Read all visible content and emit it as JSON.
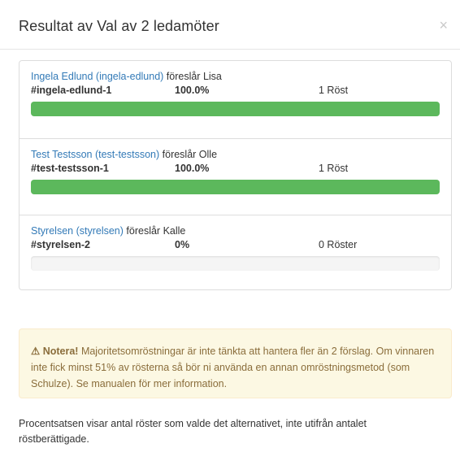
{
  "modal": {
    "title": "Resultat av Val av 2 ledamöter",
    "close_label": "×"
  },
  "results": [
    {
      "proposer_link": "Ingela Edlund (ingela-edlund)",
      "proposer_text": " föreslår Lisa",
      "alt_id": "#ingela-edlund-1",
      "percent_label": "100.0%",
      "percent_value": 100,
      "votes_label": "1 Röst"
    },
    {
      "proposer_link": "Test Testsson (test-testsson)",
      "proposer_text": " föreslår Olle",
      "alt_id": "#test-testsson-1",
      "percent_label": "100.0%",
      "percent_value": 100,
      "votes_label": "1 Röst"
    },
    {
      "proposer_link": "Styrelsen (styrelsen)",
      "proposer_text": " föreslår Kalle",
      "alt_id": "#styrelsen-2",
      "percent_label": "0%",
      "percent_value": 0,
      "votes_label": "0 Röster"
    }
  ],
  "alert": {
    "icon": "⚠",
    "icon_name": "warning-icon",
    "heading": "Notera!",
    "text": " Majoritetsomröstningar är inte tänkta att hantera fler än 2 förslag. Om vinnaren inte fick minst 51% av rösterna så bör ni använda en annan omröstningsmetod (som Schulze). Se manualen för mer information."
  },
  "footer_note": "Procentsatsen visar antal röster som valde det alternativet, inte utifrån antalet röstberättigade.",
  "colors": {
    "link": "#337ab7",
    "progress_fill": "#5cb85c",
    "alert_bg": "#fcf8e3",
    "alert_text": "#8a6d3b"
  }
}
